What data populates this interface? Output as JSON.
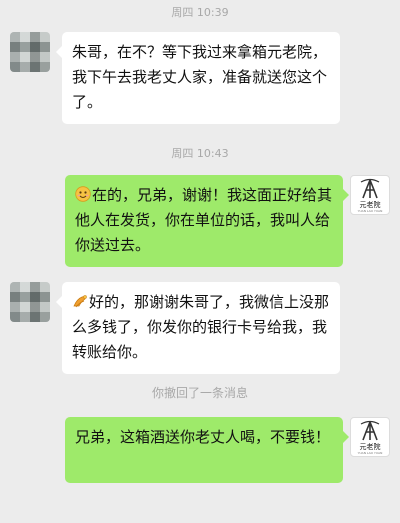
{
  "timestamps": [
    "周四 10:39",
    "周四 10:43"
  ],
  "messages": [
    {
      "side": "left",
      "text": "朱哥，在不？等下我过来拿箱元老院，我下午去我老丈人家，准备就送您这个了。"
    },
    {
      "side": "right",
      "emoji": "smile-icon",
      "text": "在的，兄弟，谢谢！我这面正好给其他人在发货，你在单位的话，我叫人给你送过去。"
    },
    {
      "side": "left",
      "emoji": "bow-icon",
      "text": "好的，那谢谢朱哥了，我微信上没那么多钱了，你发你的银行卡号给我，我转账给你。"
    },
    {
      "side": "right",
      "text": "兄弟，这箱酒送你老丈人喝，不要钱！"
    }
  ],
  "recall_notice": "你撤回了一条消息",
  "logo": {
    "main": "元老院",
    "sub": "YUAN LAO YUAN"
  },
  "colors": {
    "background": "#ececec",
    "left_bubble": "#ffffff",
    "right_bubble": "#9eea6a"
  }
}
